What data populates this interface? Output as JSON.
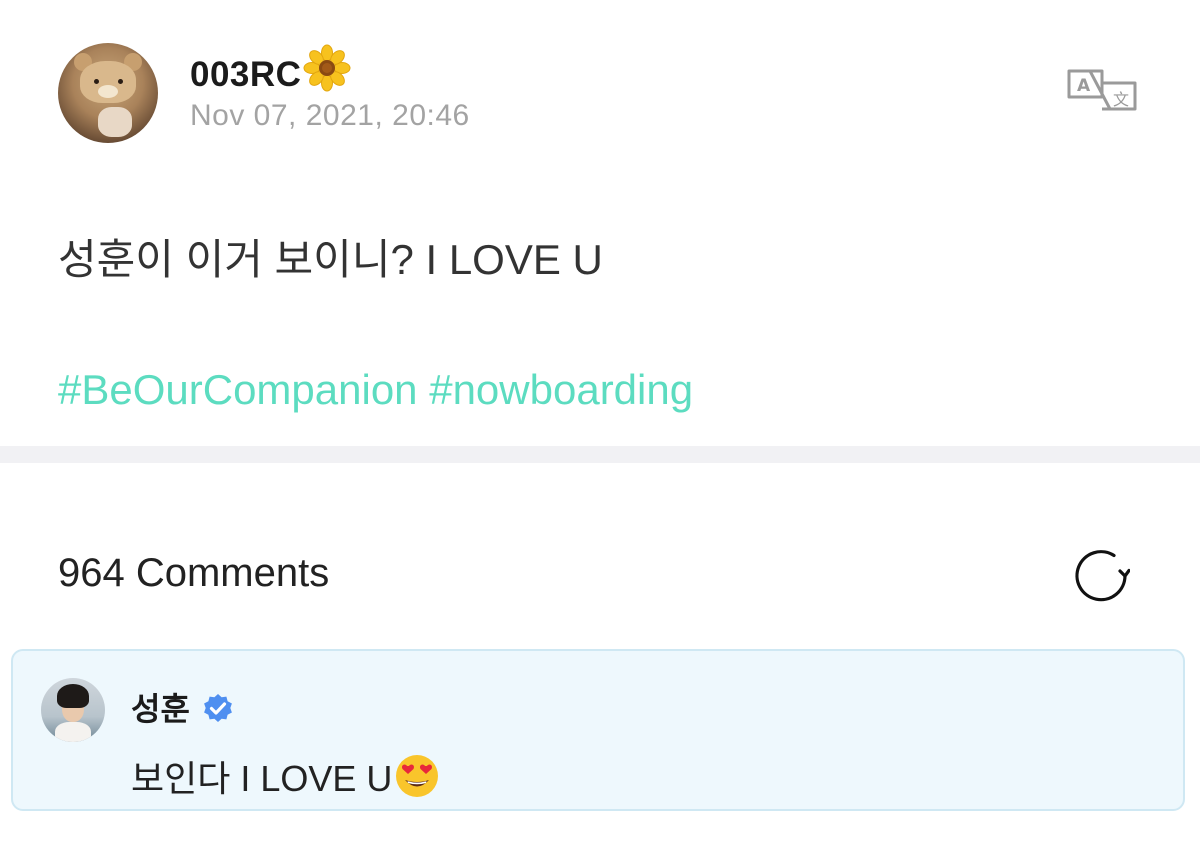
{
  "post": {
    "username": "003RC",
    "username_emoji": "flower-emoji",
    "timestamp": "Nov 07, 2021, 20:46",
    "body": "성훈이 이거 보이니? I LOVE U",
    "hashtags": [
      "#BeOurCompanion",
      "#nowboarding"
    ],
    "translate_icon": "translate-icon"
  },
  "comments_section": {
    "count_label": "964 Comments",
    "refresh_icon": "refresh-icon"
  },
  "comment": {
    "author": "성훈",
    "verified_icon": "verified-badge-icon",
    "text": "보인다 I LOVE U",
    "emoji": "heart-eyes-emoji"
  },
  "colors": {
    "hashtag": "#5cdcc0",
    "timestamp": "#a3a3a3",
    "verified": "#4f8ff0",
    "comment_bg": "#eef8fd",
    "comment_border": "#cfe8f3",
    "divider": "#f1f1f4"
  }
}
